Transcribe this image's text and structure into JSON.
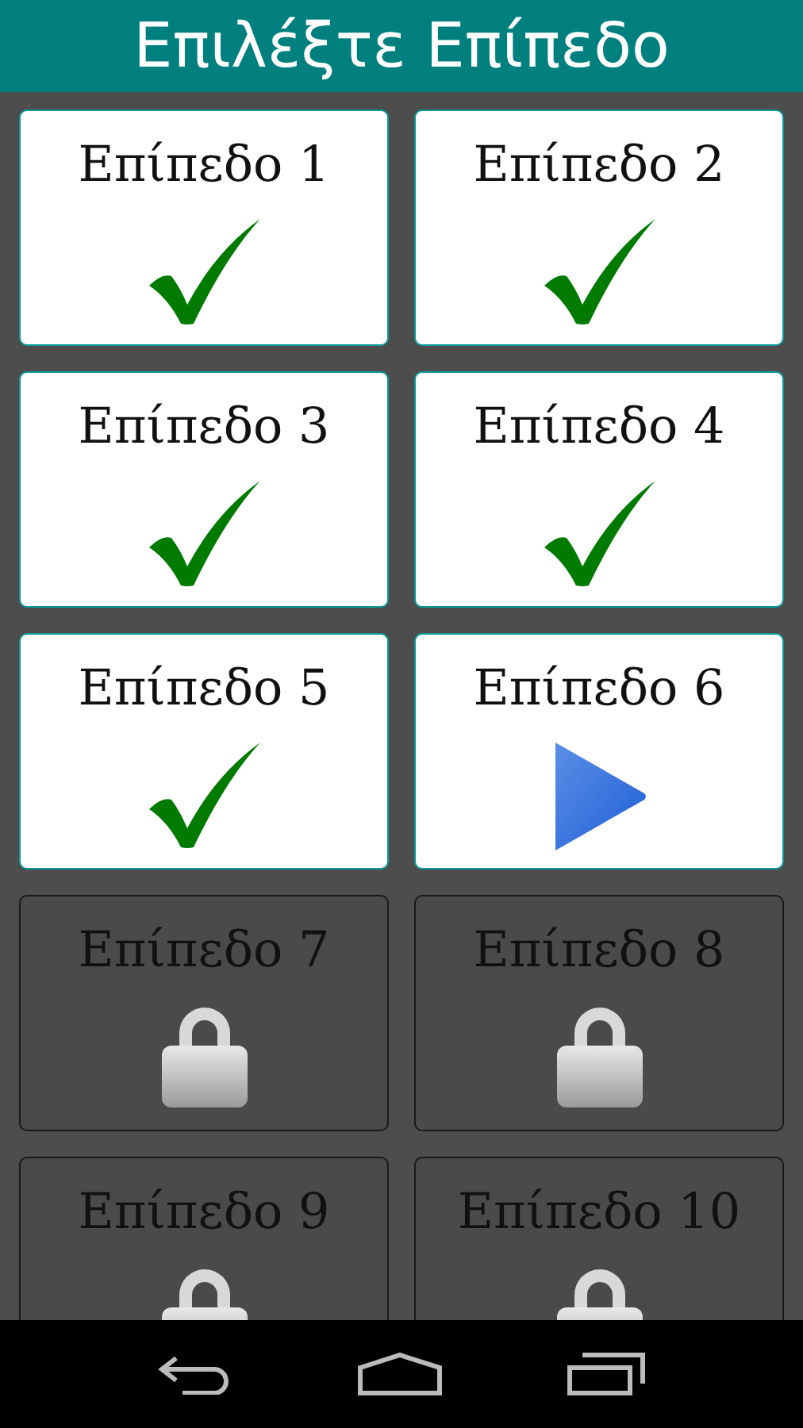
{
  "header": {
    "title": "Επιλέξτε Επίπεδο"
  },
  "levels": [
    {
      "label": "Επίπεδο 1",
      "kind": "done"
    },
    {
      "label": "Επίπεδο 2",
      "kind": "done"
    },
    {
      "label": "Επίπεδο 3",
      "kind": "done"
    },
    {
      "label": "Επίπεδο 4",
      "kind": "done"
    },
    {
      "label": "Επίπεδο 5",
      "kind": "done"
    },
    {
      "label": "Επίπεδο 6",
      "kind": "current"
    },
    {
      "label": "Επίπεδο 7",
      "kind": "locked"
    },
    {
      "label": "Επίπεδο 8",
      "kind": "locked"
    },
    {
      "label": "Επίπεδο 9",
      "kind": "locked"
    },
    {
      "label": "Επίπεδο 10",
      "kind": "locked"
    }
  ]
}
